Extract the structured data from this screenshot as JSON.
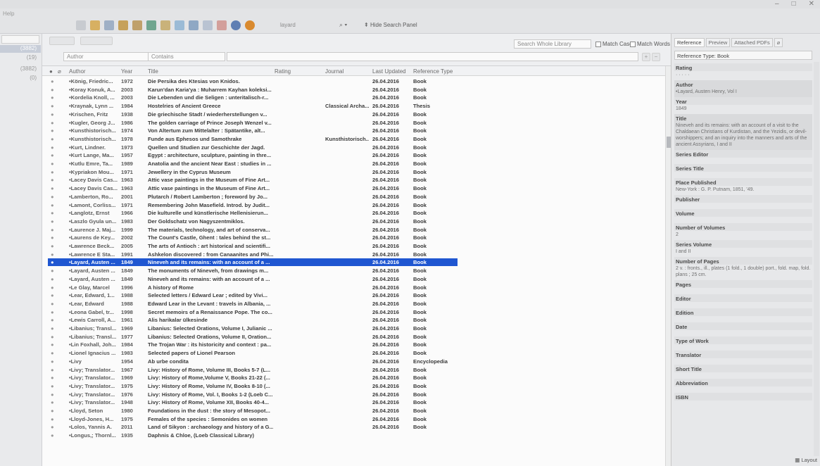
{
  "menu": {
    "items": [
      "Help"
    ]
  },
  "toolbar": {
    "search_value": "layard",
    "hide_search_panel_label": "Hide Search Panel"
  },
  "search_panel": {
    "field_1": "Author",
    "operator_1": "Contains",
    "scope": "Search Whole Library",
    "match_case": "Match Case",
    "match_words": "Match Words"
  },
  "groups": {
    "counts": [
      "(3882)",
      "(19)",
      "(3882)",
      "(0)"
    ]
  },
  "table": {
    "headers": {
      "author": "Author",
      "year": "Year",
      "title": "Title",
      "rating": "Rating",
      "journal": "Journal",
      "last_updated": "Last Updated",
      "reference_type": "Reference Type"
    },
    "rows": [
      {
        "author": "•König, Friedric...",
        "year": "1972",
        "title": "Die Persika des Ktesias von Knidos.",
        "journal": "",
        "updated": "26.04.2016",
        "type": "Book"
      },
      {
        "author": "•Koray Konuk, A...",
        "year": "2003",
        "title": "Karun'dan Karia'ya : Muharrem Kayhan koleksi...",
        "journal": "",
        "updated": "26.04.2016",
        "type": "Book"
      },
      {
        "author": "•Kordelia Knoll, ...",
        "year": "2003",
        "title": "Die Lebenden und die Seligen : unteritalisch-r...",
        "journal": "",
        "updated": "26.04.2016",
        "type": "Book"
      },
      {
        "author": "•Kraynak, Lynn ...",
        "year": "1984",
        "title": "Hostelries of Ancient Greece",
        "journal": "Classical Archa...",
        "updated": "26.04.2016",
        "type": "Thesis"
      },
      {
        "author": "•Krischen, Fritz",
        "year": "1938",
        "title": "Die griechische Stadt / wiederherstellungen v...",
        "journal": "",
        "updated": "26.04.2016",
        "type": "Book"
      },
      {
        "author": "•Kugler, Georg J...",
        "year": "1986",
        "title": "The golden carriage of Prince Joseph Wenzel v...",
        "journal": "",
        "updated": "26.04.2016",
        "type": "Book"
      },
      {
        "author": "•Kunsthistorisch...",
        "year": "1974",
        "title": "Von Altertum zum Mittelalter : Spätantike, alt...",
        "journal": "",
        "updated": "26.04.2016",
        "type": "Book"
      },
      {
        "author": "•Kunsthistorisch...",
        "year": "1978",
        "title": "Funde aus Ephesos und Samothrake",
        "journal": "Kunsthistorisch...",
        "updated": "26.04.2016",
        "type": "Book"
      },
      {
        "author": "•Kurt, Lindner.",
        "year": "1973",
        "title": "Quellen und Studien zur Geschichte der Jagd.",
        "journal": "",
        "updated": "26.04.2016",
        "type": "Book"
      },
      {
        "author": "•Kurt Lange, Ma...",
        "year": "1957",
        "title": "Egypt : architecture, sculpture, painting in thre...",
        "journal": "",
        "updated": "26.04.2016",
        "type": "Book"
      },
      {
        "author": "•Kutlu Emre, Ta...",
        "year": "1989",
        "title": "Anatolia and the ancient Near East : studies in ...",
        "journal": "",
        "updated": "26.04.2016",
        "type": "Book"
      },
      {
        "author": "•Kypriakon Mou...",
        "year": "1971",
        "title": "Jewellery in the Cyprus Museum",
        "journal": "",
        "updated": "26.04.2016",
        "type": "Book"
      },
      {
        "author": "•Lacey Davis Cas...",
        "year": "1963",
        "title": "Attic vase paintings in the Museum of Fine Art...",
        "journal": "",
        "updated": "26.04.2016",
        "type": "Book"
      },
      {
        "author": "•Lacey Davis Cas...",
        "year": "1963",
        "title": "Attic vase paintings in the Museum of Fine Art...",
        "journal": "",
        "updated": "26.04.2016",
        "type": "Book"
      },
      {
        "author": "•Lamberton, Ro...",
        "year": "2001",
        "title": "Plutarch / Robert Lamberton ; foreword by Jo...",
        "journal": "",
        "updated": "26.04.2016",
        "type": "Book"
      },
      {
        "author": "•Lamont, Corliss...",
        "year": "1971",
        "title": "Remembering John Masefield. Introd. by Judit...",
        "journal": "",
        "updated": "26.04.2016",
        "type": "Book"
      },
      {
        "author": "•Langlotz, Ernst",
        "year": "1966",
        "title": "Die kulturelle und künstlerische Hellenisierun...",
        "journal": "",
        "updated": "26.04.2016",
        "type": "Book"
      },
      {
        "author": "•Laszlo Gyula un...",
        "year": "1983",
        "title": "Der Goldschatz von Nagyszentmiklos.",
        "journal": "",
        "updated": "26.04.2016",
        "type": "Book"
      },
      {
        "author": "•Laurence J. Maj...",
        "year": "1999",
        "title": "The materials, technology, and art of conserva...",
        "journal": "",
        "updated": "26.04.2016",
        "type": "Book"
      },
      {
        "author": "•Laurens de Key...",
        "year": "2002",
        "title": "The Count's Castle, Ghent : tales behind the st...",
        "journal": "",
        "updated": "26.04.2016",
        "type": "Book"
      },
      {
        "author": "•Lawrence Beck...",
        "year": "2005",
        "title": "The arts of Antioch : art historical and scientifi...",
        "journal": "",
        "updated": "26.04.2016",
        "type": "Book"
      },
      {
        "author": "•Lawrence E Sta...",
        "year": "1991",
        "title": "Ashkelon discovered : from Canaanites and Phi...",
        "journal": "",
        "updated": "26.04.2016",
        "type": "Book"
      },
      {
        "author": "•Layard, Austen ...",
        "year": "1849",
        "title": "Nineveh and its remains: with an account of a ...",
        "journal": "",
        "updated": "26.04.2016",
        "type": "Book",
        "selected": true
      },
      {
        "author": "•Layard, Austen ...",
        "year": "1849",
        "title": "The monuments of Nineveh, from drawings m...",
        "journal": "",
        "updated": "26.04.2016",
        "type": "Book"
      },
      {
        "author": "•Layard, Austen ...",
        "year": "1849",
        "title": "Nineveh and its remains: with an account of a ...",
        "journal": "",
        "updated": "26.04.2016",
        "type": "Book"
      },
      {
        "author": "•Le Glay, Marcel",
        "year": "1996",
        "title": "A history of Rome",
        "journal": "",
        "updated": "26.04.2016",
        "type": "Book"
      },
      {
        "author": "•Lear, Edward, 1...",
        "year": "1988",
        "title": "Selected letters / Edward Lear ; edited by Vivi...",
        "journal": "",
        "updated": "26.04.2016",
        "type": "Book"
      },
      {
        "author": "•Lear, Edward",
        "year": "1988",
        "title": "Edward Lear in the Levant : travels in Albania, ...",
        "journal": "",
        "updated": "26.04.2016",
        "type": "Book"
      },
      {
        "author": "•Leona Gabel, tr...",
        "year": "1998",
        "title": "Secret memoirs of a Renaissance Pope. The co...",
        "journal": "",
        "updated": "26.04.2016",
        "type": "Book"
      },
      {
        "author": "•Lewis Carroll, A...",
        "year": "1961",
        "title": "Alis harikalar ülkesinde",
        "journal": "",
        "updated": "26.04.2016",
        "type": "Book"
      },
      {
        "author": "•Libanius; Transl...",
        "year": "1969",
        "title": "Libanius: Selected Orations, Volume I, Julianic ...",
        "journal": "",
        "updated": "26.04.2016",
        "type": "Book"
      },
      {
        "author": "•Libanius; Transl...",
        "year": "1977",
        "title": "Libanius: Selected Orations, Volume II, Oration...",
        "journal": "",
        "updated": "26.04.2016",
        "type": "Book"
      },
      {
        "author": "•Lin Foxhall, Joh...",
        "year": "1984",
        "title": "The Trojan War : its historicity and context : pa...",
        "journal": "",
        "updated": "26.04.2016",
        "type": "Book"
      },
      {
        "author": "•Lionel Ignacius ...",
        "year": "1983",
        "title": "Selected papers of Lionel Pearson",
        "journal": "",
        "updated": "26.04.2016",
        "type": "Book"
      },
      {
        "author": "•Livy",
        "year": "1954",
        "title": "Ab urbe condita",
        "journal": "",
        "updated": "26.04.2016",
        "type": "Encyclopedia"
      },
      {
        "author": "•Livy; Translator...",
        "year": "1967",
        "title": "Livy: History of Rome, Volume III, Books 5-7 (L...",
        "journal": "",
        "updated": "26.04.2016",
        "type": "Book"
      },
      {
        "author": "•Livy; Translator...",
        "year": "1969",
        "title": "Livy: History of Rome,Volume V, Books 21-22 (...",
        "journal": "",
        "updated": "26.04.2016",
        "type": "Book"
      },
      {
        "author": "•Livy; Translator...",
        "year": "1975",
        "title": "Livy: History of Rome, Volume IV, Books 8-10 (...",
        "journal": "",
        "updated": "26.04.2016",
        "type": "Book"
      },
      {
        "author": "•Livy; Translator...",
        "year": "1976",
        "title": "Livy: History of Rome, Vol. I, Books 1-2 (Loeb C...",
        "journal": "",
        "updated": "26.04.2016",
        "type": "Book"
      },
      {
        "author": "•Livy; Translator...",
        "year": "1948",
        "title": "Livy: History of Rome, Volume XII, Books 40-4...",
        "journal": "",
        "updated": "26.04.2016",
        "type": "Book"
      },
      {
        "author": "•Lloyd, Seton",
        "year": "1980",
        "title": "Foundations in the dust : the story of Mesopot...",
        "journal": "",
        "updated": "26.04.2016",
        "type": "Book"
      },
      {
        "author": "•Lloyd-Jones, H...",
        "year": "1975",
        "title": "Females of the species : Semonides on women",
        "journal": "",
        "updated": "26.04.2016",
        "type": "Book"
      },
      {
        "author": "•Lolos, Yannis A.",
        "year": "2011",
        "title": "Land of Sikyon : archaeology and history of a G...",
        "journal": "",
        "updated": "26.04.2016",
        "type": "Book"
      },
      {
        "author": "•Longus,; Thornl...",
        "year": "1935",
        "title": "Daphnis & Chloe, (Loeb Classical Library)",
        "journal": "",
        "updated": "",
        "type": ""
      }
    ]
  },
  "ref_pane": {
    "tabs": [
      "Reference",
      "Preview",
      "Attached PDFs"
    ],
    "reference_type_label": "Reference Type: Book",
    "fields": [
      {
        "label": "Rating",
        "value": "· · · · ·"
      },
      {
        "label": "Author",
        "value": "•Layard, Austen Henry, Vol I"
      },
      {
        "label": "Year",
        "value": "1849"
      },
      {
        "label": "Title",
        "value": "Nineveh and its remains: with an account of a visit to the Chaldaean Christians of Kurdistan, and the Yezidis, or devil-worshippers; and an inquiry into the manners and arts of the ancient Assyrians, I and II"
      },
      {
        "label": "Series Editor",
        "value": ""
      },
      {
        "label": "Series Title",
        "value": ""
      },
      {
        "label": "Place Published",
        "value": "New-York : G. P. Putnam, 1851, '49."
      },
      {
        "label": "Publisher",
        "value": ""
      },
      {
        "label": "Volume",
        "value": ""
      },
      {
        "label": "Number of Volumes",
        "value": "2"
      },
      {
        "label": "Series Volume",
        "value": "I and II"
      },
      {
        "label": "Number of Pages",
        "value": "2 v. : fronts., ill., plates (1 fold., 1 double) port., fold. map, fold. plans ; 25 cm."
      },
      {
        "label": "Pages",
        "value": ""
      },
      {
        "label": "Editor",
        "value": ""
      },
      {
        "label": "Edition",
        "value": ""
      },
      {
        "label": "Date",
        "value": ""
      },
      {
        "label": "Type of Work",
        "value": ""
      },
      {
        "label": "Translator",
        "value": ""
      },
      {
        "label": "Short Title",
        "value": ""
      },
      {
        "label": "Abbreviation",
        "value": ""
      },
      {
        "label": "ISBN",
        "value": ""
      }
    ],
    "layout_label": "Layout"
  }
}
